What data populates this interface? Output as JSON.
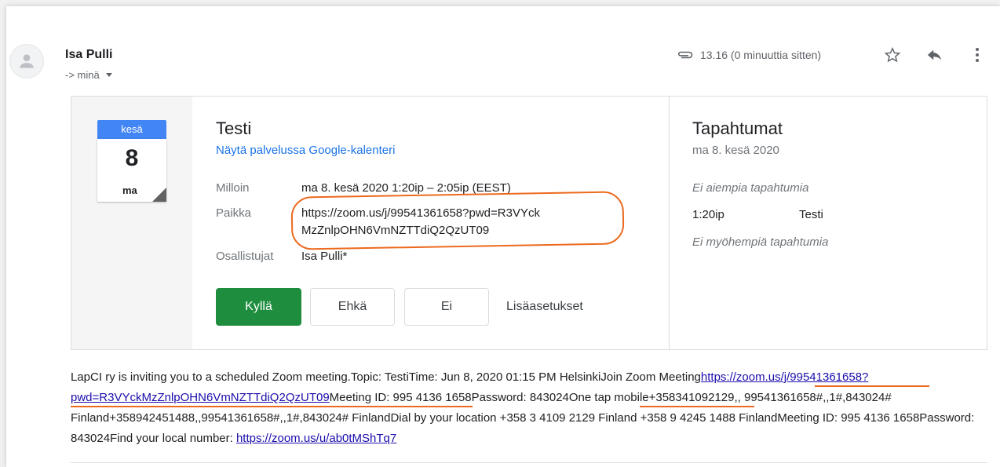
{
  "sender": {
    "name": "Isa Pulli",
    "recipient": "-> minä"
  },
  "meta": {
    "time": "13.16 (0 minuuttia sitten)"
  },
  "icons": {
    "attachment": "paperclip-icon",
    "star": "star-icon",
    "reply": "reply-icon",
    "more": "more-vert-icon",
    "avatar": "person-icon"
  },
  "invite": {
    "calendar": {
      "month": "kesä",
      "day": "8",
      "weekday": "ma"
    },
    "title": "Testi",
    "link": "Näytä palvelussa Google-kalenteri",
    "when_label": "Milloin",
    "when_value": "ma 8. kesä 2020 1:20ip – 2:05ip (EEST)",
    "where_label": "Paikka",
    "where_line1": "https://zoom.us/j/99541361658?pwd=R3VYck",
    "where_line2": "MzZnlpOHN6VmNZTTdiQ2QzUT09",
    "guests_label": "Osallistujat",
    "guests_value": "Isa Pulli*",
    "buttons": {
      "yes": "Kyllä",
      "maybe": "Ehkä",
      "no": "Ei",
      "more": "Lisäasetukset"
    },
    "colors": {
      "yes_button": "#1e8e3e",
      "calendar_head": "#4285f4",
      "link": "#1a73e8",
      "annotation": "#ec6a1f"
    }
  },
  "events": {
    "heading": "Tapahtumat",
    "date": "ma 8. kesä 2020",
    "no_earlier": "Ei aiempia tapahtumia",
    "item_time": "1:20ip",
    "item_name": "Testi",
    "no_later": "Ei myöhempiä tapahtumia"
  },
  "body": {
    "seg1": "LapCI ry is inviting you to a scheduled Zoom meeting.Topic: TestiTime: Jun 8, 2020 01:15 PM HelsinkiJoin Zoom Meeting",
    "link1": "https://zoom.us/j/99541361658?pwd=R3VYckMzZnlpOHN6VmNZTTdiQ2QzUT09",
    "seg2": "Meeting ID: 995 4136 1658",
    "seg3": "Password: 843024",
    "seg4": "One tap mobile+358341092129,, 99541361658#,,1#,843024# Finland+358942451488,,99541361658#,,1#,843024# FinlandDial by your location        +358 3 4109 2129 Finland +358 9 4245 1488 FinlandMeeting ID: 995 4136 1658Password: 843024Find your local number: ",
    "link2": "https://zoom.us/u/ab0tMShTq7"
  }
}
